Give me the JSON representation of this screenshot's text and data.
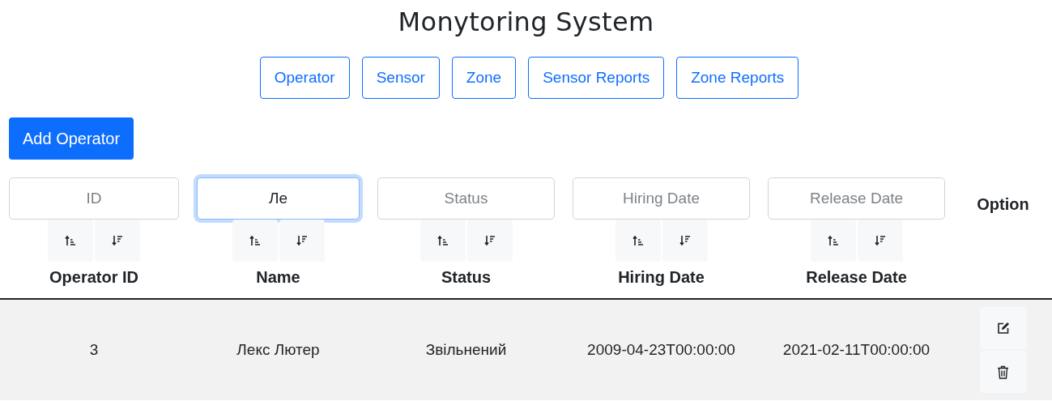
{
  "title": "Monytoring System",
  "nav": [
    {
      "label": "Operator"
    },
    {
      "label": "Sensor"
    },
    {
      "label": "Zone"
    },
    {
      "label": "Sensor Reports"
    },
    {
      "label": "Zone Reports"
    }
  ],
  "add_button": "Add Operator",
  "columns": [
    {
      "kind": "sortable",
      "filter": {
        "placeholder": "ID",
        "focused": false
      },
      "label": "Operator ID"
    },
    {
      "kind": "sortable",
      "filter": {
        "value": "Ле",
        "focused": true
      },
      "label": "Name"
    },
    {
      "kind": "sortable",
      "filter": {
        "placeholder": "Status",
        "focused": false
      },
      "label": "Status"
    },
    {
      "kind": "sortable",
      "filter": {
        "placeholder": "Hiring Date",
        "focused": false
      },
      "label": "Hiring Date"
    },
    {
      "kind": "sortable",
      "filter": {
        "placeholder": "Release Date",
        "focused": false
      },
      "label": "Release Date"
    },
    {
      "kind": "options",
      "label": "Option"
    }
  ],
  "rows": [
    {
      "cells": [
        "3",
        "Лекс Лютер",
        "Звільнений",
        "2009-04-23T00:00:00",
        "2021-02-11T00:00:00"
      ]
    }
  ]
}
